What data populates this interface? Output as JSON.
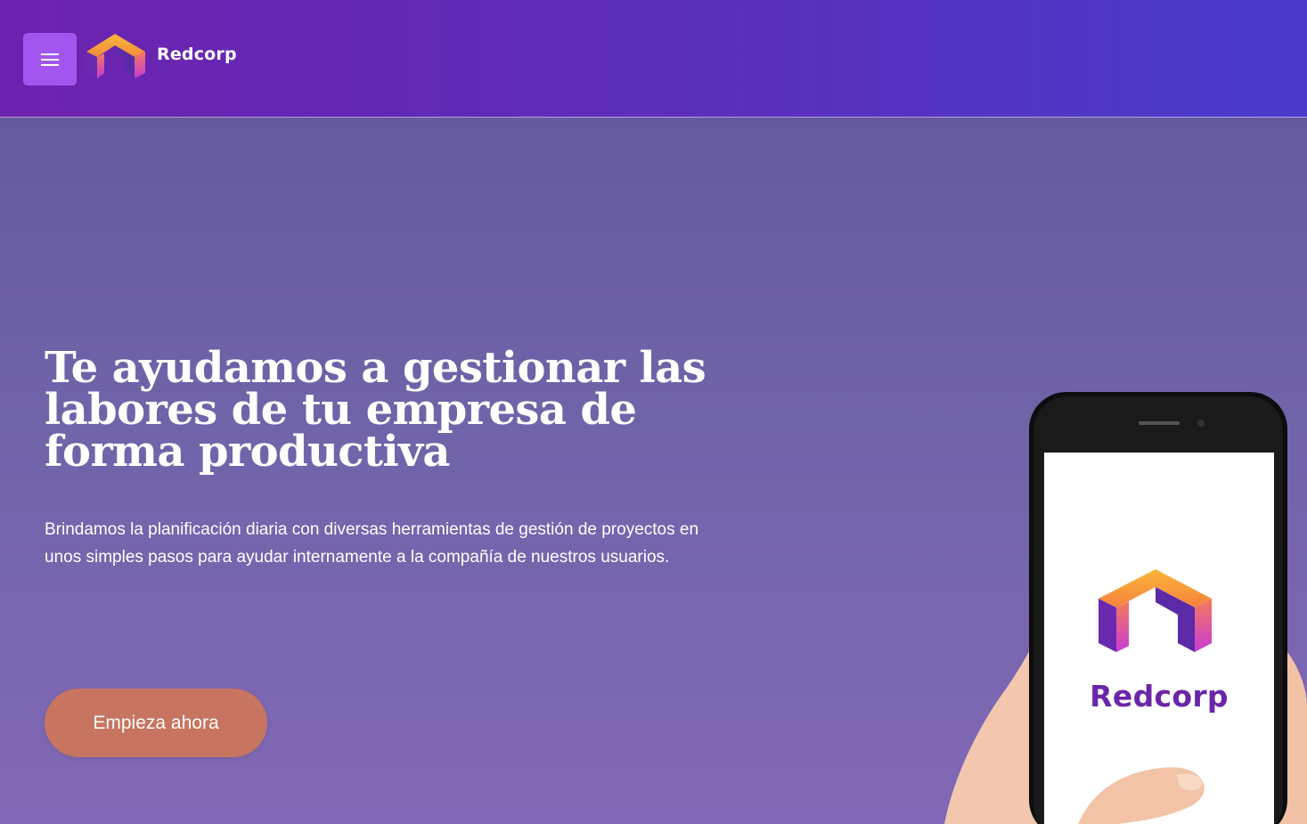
{
  "navbar": {
    "brand": "Redcorp",
    "menu_icon": "hamburger-menu-icon",
    "logo_icon": "redcorp-logo-icon"
  },
  "hero": {
    "title": "Te ayudamos a gestionar las labores de tu empresa de forma productiva",
    "description": "Brindamos la planificación diaria con diversas herramientas de gestión de proyectos en unos simples pasos para ayudar internamente a la compañía de nuestros usuarios.",
    "cta_label": "Empieza ahora",
    "phone_brand": "Redcorp"
  },
  "colors": {
    "nav_gradient_start": "#6d22ad",
    "nav_gradient_end": "#4a3bcc",
    "menu_button": "#a356ef",
    "hero_background": "#7164a9",
    "cta_button": "#c77560",
    "phone_brand_text": "#6a25a8"
  }
}
